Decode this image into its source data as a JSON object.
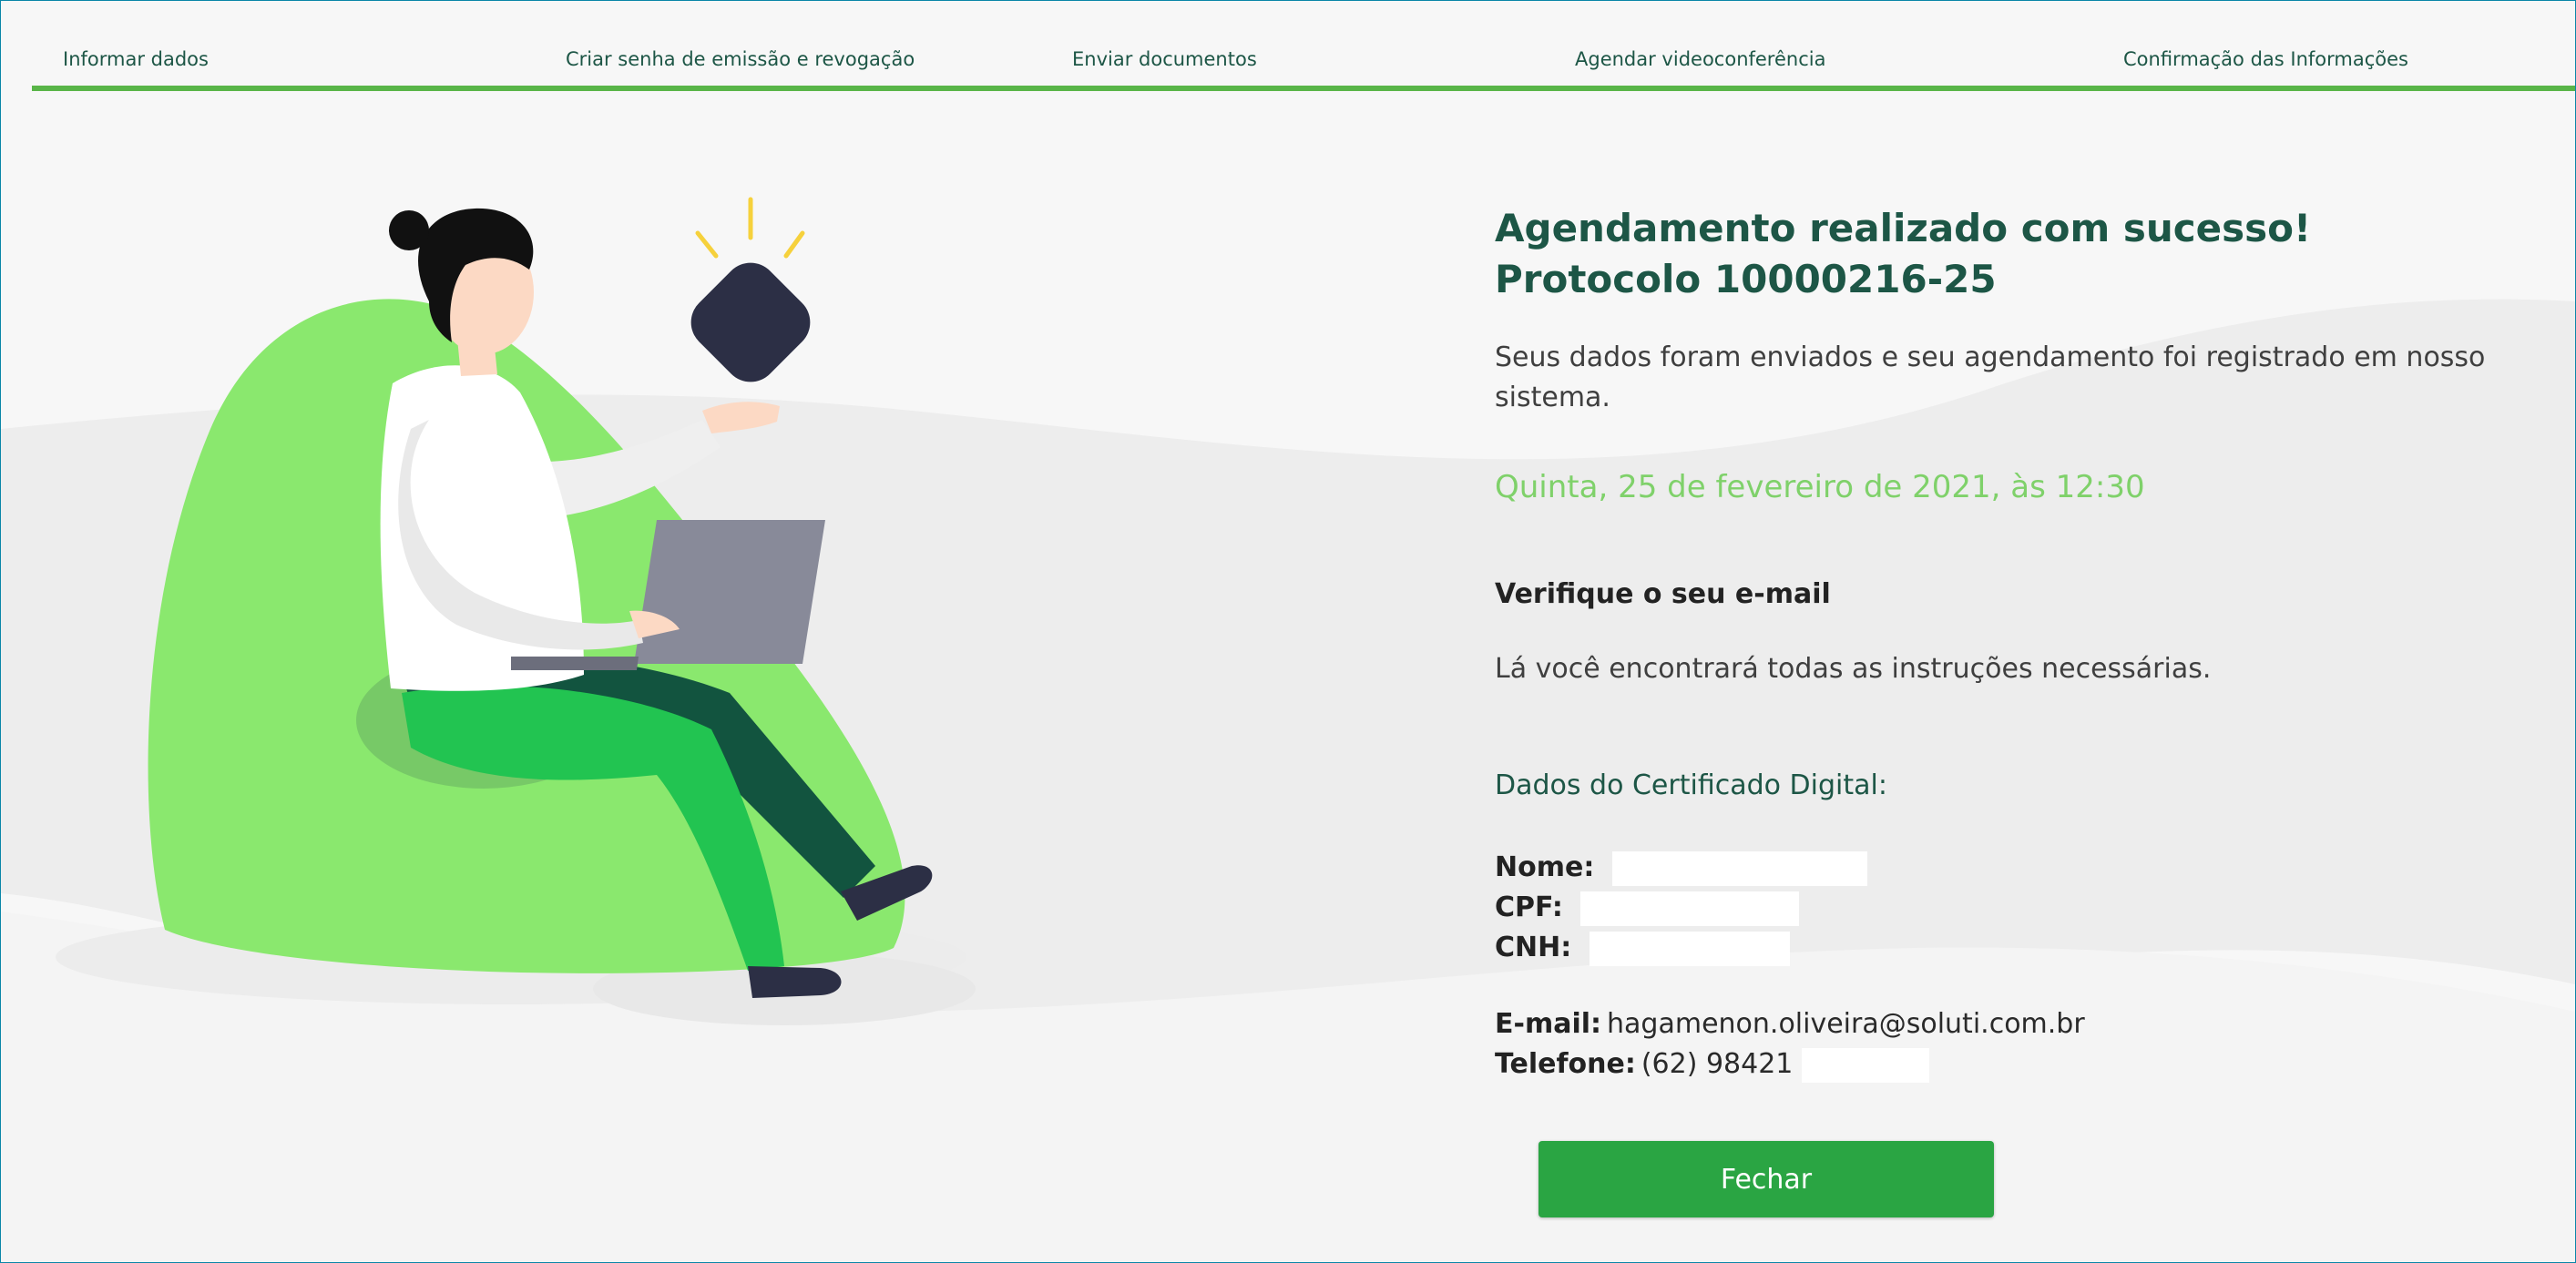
{
  "steps": [
    "Informar dados",
    "Criar senha de emissão e revogação",
    "Enviar documentos",
    "Agendar videoconferência",
    "Confirmação das Informações"
  ],
  "success": {
    "title_line1": "Agendamento realizado com sucesso!",
    "title_line2": "Protocolo 10000216-25",
    "description": "Seus dados foram enviados e seu agendamento foi registrado em nosso sistema.",
    "date": "Quinta, 25 de fevereiro de 2021, às 12:30",
    "check_title": "Verifique o seu e-mail",
    "check_text": "Lá você encontrará todas as instruções necessárias."
  },
  "certificate": {
    "title": "Dados do Certificado Digital:",
    "name_label": "Nome:",
    "cpf_label": "CPF:",
    "cnh_label": "CNH:",
    "email_label": "E-mail:",
    "email_value": "hagamenon.oliveira@soluti.com.br",
    "phone_label": "Telefone:",
    "phone_value": "(62) 98421"
  },
  "button": {
    "close_label": "Fechar"
  },
  "colors": {
    "accent_green": "#59b548",
    "dark_green": "#1d5646",
    "date_green": "#7fd16a",
    "button_green": "#2aa543"
  },
  "icons": [
    "woman-with-laptop-illustration",
    "floating-app-icon"
  ]
}
